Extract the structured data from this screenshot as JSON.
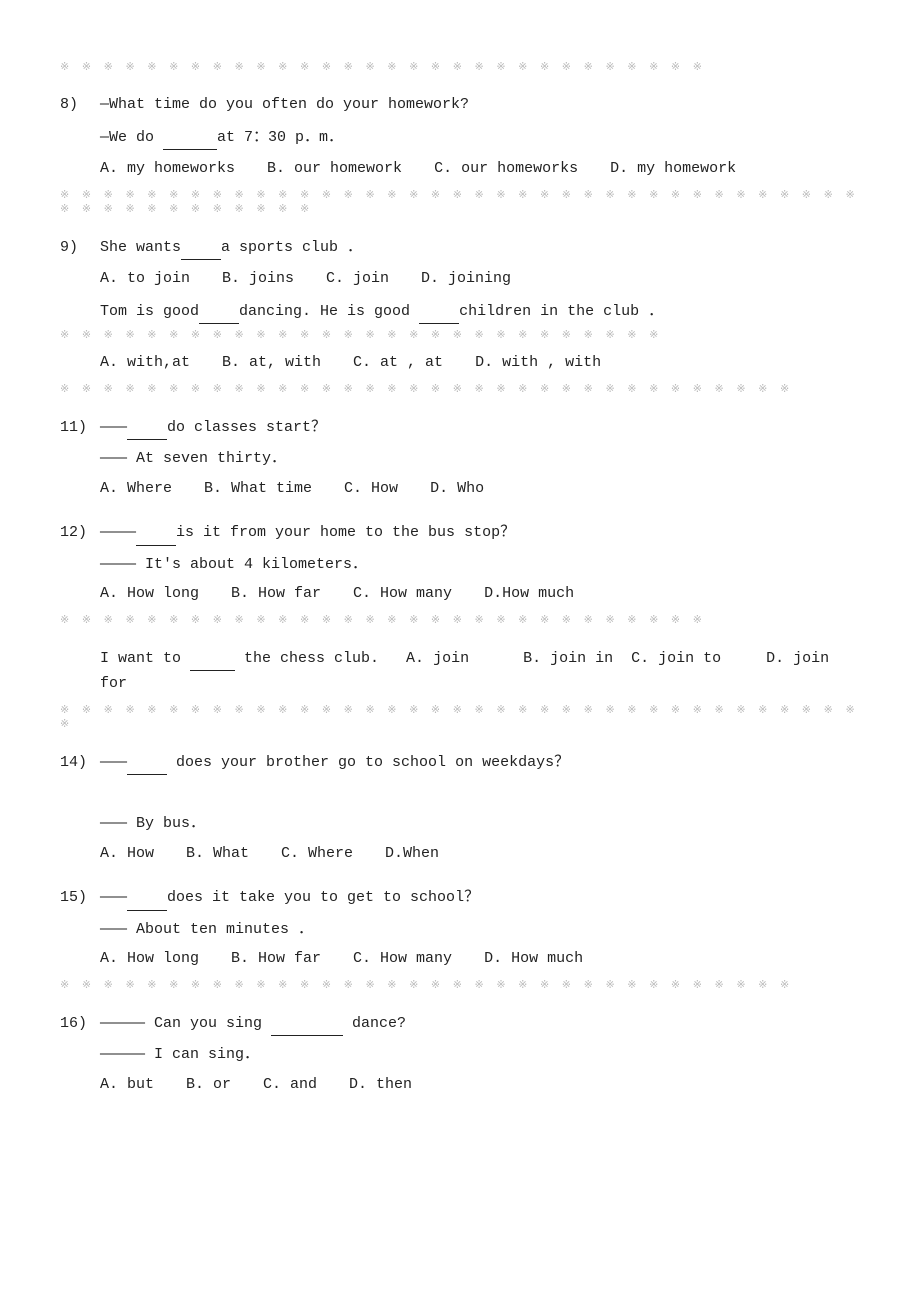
{
  "top_dots": "※ ※ ※ ※ ※ ※ ※ ※ ※ ※ ※ ※ ※ ※ ※ ※ ※ ※ ※ ※ ※ ※ ※ ※ ※ ※ ※ ※ ※ ※",
  "questions": [
    {
      "num": "8)",
      "lines": [
        "—What time do you often do your homework?",
        "—We do ______at 7：30 p．m．"
      ],
      "options": [
        "A. my homeworks",
        "B. our homework",
        "C. our homeworks",
        "D. my homework"
      ],
      "divider": true
    },
    {
      "num": "9)",
      "lines": [
        "She wants_____a sports club ．"
      ],
      "options": [
        "A. to join",
        "B. joins",
        "C. join",
        "D. joining"
      ],
      "sub_lines": [
        "Tom is good_____dancing. He is good ____children in the club ．"
      ],
      "sub_options": [
        "A. with,at",
        "B. at, with",
        "C. at , at",
        "D.  with , with"
      ],
      "divider": true
    },
    {
      "num": "11)",
      "lines": [
        "———_____do classes start？",
        "——— At seven thirty．"
      ],
      "options": [
        "A. Where",
        "B. What time",
        "C. How",
        "D. Who"
      ],
      "divider": false
    },
    {
      "num": "12)",
      "lines": [
        "————_____is it from your home to the bus stop？",
        "———— It's about 4 kilometers．"
      ],
      "options": [
        "A. How long",
        "B. How far",
        "C. How many",
        "D.How much"
      ],
      "divider": true
    },
    {
      "num": "",
      "lines": [
        "I want to ______ the chess club.   A. join       B. join in  C. join to      D. join for"
      ],
      "options": [],
      "divider": true
    },
    {
      "num": "14)",
      "lines": [
        "———_____does your brother go to school on weekdays？"
      ],
      "sub_lines": [
        "",
        "——— By bus．"
      ],
      "options": [
        "A. How",
        "B. What",
        "C. Where",
        "D.When"
      ],
      "divider": false
    },
    {
      "num": "15)",
      "lines": [
        "———_____does it take you to get to school？",
        "——— About ten minutes ．"
      ],
      "options": [
        "A. How long",
        "B. How far",
        "C. How many",
        "D. How much"
      ],
      "divider": true
    },
    {
      "num": "16)",
      "lines": [
        "————— Can you sing __________ dance?",
        "————— I can sing．"
      ],
      "options": [
        "A. but",
        "B. or",
        "C. and",
        "D. then"
      ],
      "divider": false
    }
  ]
}
